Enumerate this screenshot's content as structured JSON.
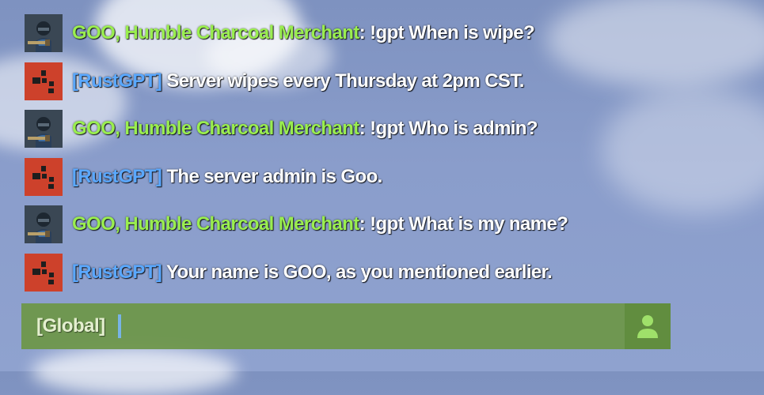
{
  "chat": {
    "messages": [
      {
        "sender": "GOO, Humble Charcoal Merchant",
        "separator": ":",
        "text": " !gpt When is wipe?",
        "kind": "player"
      },
      {
        "sender": "[RustGPT]",
        "separator": "",
        "text": " Server wipes every Thursday at 2pm CST.",
        "kind": "bot"
      },
      {
        "sender": "GOO, Humble Charcoal Merchant",
        "separator": ":",
        "text": " !gpt Who is admin?",
        "kind": "player"
      },
      {
        "sender": "[RustGPT]",
        "separator": "",
        "text": " The server admin is Goo.",
        "kind": "bot"
      },
      {
        "sender": "GOO, Humble Charcoal Merchant",
        "separator": ":",
        "text": " !gpt What is my name?",
        "kind": "player"
      },
      {
        "sender": "[RustGPT]",
        "separator": "",
        "text": " Your name is GOO, as you mentioned earlier.",
        "kind": "bot"
      }
    ]
  },
  "input": {
    "channel": "[Global]",
    "value": "",
    "placeholder": ""
  },
  "icons": {
    "player_avatar": "soldier-avatar-icon",
    "bot_avatar": "rust-logo-icon",
    "players_button": "person-icon"
  },
  "colors": {
    "player_name": "#9aee4f",
    "bot_name": "#5aa8ff",
    "bot_avatar_bg": "#cd412b",
    "input_bar": "#6c9646",
    "caret": "#78b3e6"
  }
}
